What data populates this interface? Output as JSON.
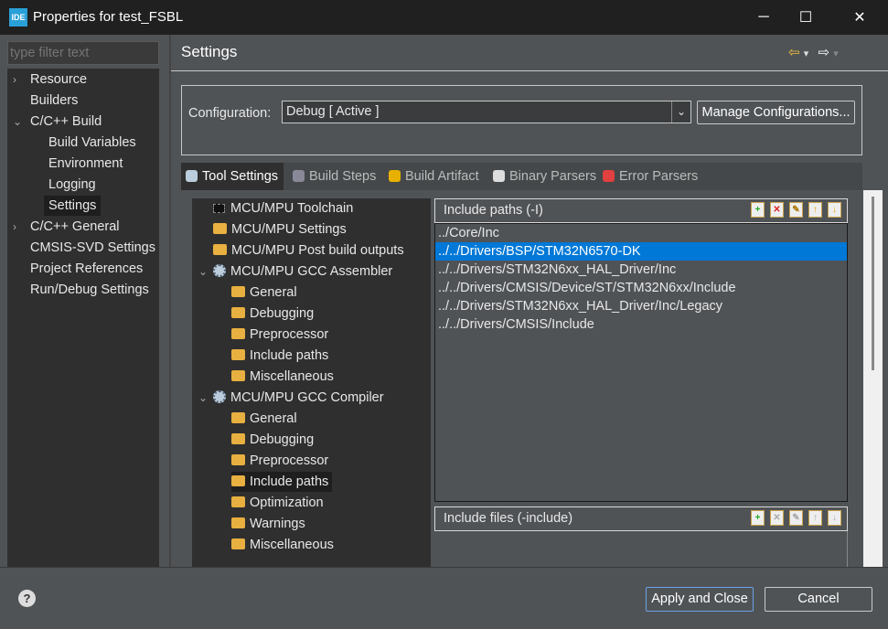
{
  "window": {
    "title": "Properties for test_FSBL",
    "logo": "IDE",
    "minimize": "─",
    "maximize": "☐",
    "close": "✕"
  },
  "filter": {
    "placeholder": "type filter text"
  },
  "left_tree": [
    {
      "label": "Resource",
      "chev": "›"
    },
    {
      "label": "Builders"
    },
    {
      "label": "C/C++ Build",
      "chev": "⌄"
    },
    {
      "label": "Build Variables",
      "child": true
    },
    {
      "label": "Environment",
      "child": true
    },
    {
      "label": "Logging",
      "child": true
    },
    {
      "label": "Settings",
      "child": true,
      "selected": true
    },
    {
      "label": "C/C++ General",
      "chev": "›"
    },
    {
      "label": "CMSIS-SVD Settings"
    },
    {
      "label": "Project References"
    },
    {
      "label": "Run/Debug Settings"
    }
  ],
  "header": {
    "title": "Settings",
    "back": "⇦",
    "forward": "⇨",
    "dropdown": "▾"
  },
  "configuration": {
    "label": "Configuration:",
    "value": "Debug  [ Active ]",
    "manage": "Manage Configurations..."
  },
  "tabs": [
    {
      "label": "Tool Settings",
      "icon": "gear-icon",
      "active": true
    },
    {
      "label": "Build Steps",
      "icon": "build-steps-icon"
    },
    {
      "label": "Build Artifact",
      "icon": "trophy-icon"
    },
    {
      "label": "Binary Parsers",
      "icon": "binary-icon"
    },
    {
      "label": "Error Parsers",
      "icon": "error-icon"
    }
  ],
  "tool_tree": [
    {
      "label": "MCU/MPU Toolchain",
      "icon": "chip",
      "lvl": 0
    },
    {
      "label": "MCU/MPU Settings",
      "icon": "fold",
      "lvl": 0
    },
    {
      "label": "MCU/MPU Post build outputs",
      "icon": "fold",
      "lvl": 0
    },
    {
      "label": "MCU/MPU GCC Assembler",
      "icon": "gear",
      "lvl": 0,
      "chev": "⌄"
    },
    {
      "label": "General",
      "icon": "fold",
      "lvl": 1
    },
    {
      "label": "Debugging",
      "icon": "fold",
      "lvl": 1
    },
    {
      "label": "Preprocessor",
      "icon": "fold",
      "lvl": 1
    },
    {
      "label": "Include paths",
      "icon": "fold",
      "lvl": 1
    },
    {
      "label": "Miscellaneous",
      "icon": "fold",
      "lvl": 1
    },
    {
      "label": "MCU/MPU GCC Compiler",
      "icon": "gear",
      "lvl": 0,
      "chev": "⌄"
    },
    {
      "label": "General",
      "icon": "fold",
      "lvl": 1
    },
    {
      "label": "Debugging",
      "icon": "fold",
      "lvl": 1
    },
    {
      "label": "Preprocessor",
      "icon": "fold",
      "lvl": 1
    },
    {
      "label": "Include paths",
      "icon": "fold",
      "lvl": 1,
      "selected": true
    },
    {
      "label": "Optimization",
      "icon": "fold",
      "lvl": 1
    },
    {
      "label": "Warnings",
      "icon": "fold",
      "lvl": 1
    },
    {
      "label": "Miscellaneous",
      "icon": "fold",
      "lvl": 1
    }
  ],
  "include_paths": {
    "title": "Include paths (-I)",
    "items": [
      "../Core/Inc",
      "../../Drivers/BSP/STM32N6570-DK",
      "../../Drivers/STM32N6xx_HAL_Driver/Inc",
      "../../Drivers/CMSIS/Device/ST/STM32N6xx/Include",
      "../../Drivers/STM32N6xx_HAL_Driver/Inc/Legacy",
      "../../Drivers/CMSIS/Include"
    ],
    "selected_index": 1
  },
  "include_files": {
    "title": "Include files (-include)"
  },
  "toolbar_icons": [
    "add-icon",
    "delete-icon",
    "edit-icon",
    "move-up-icon",
    "move-down-icon"
  ],
  "footer": {
    "help": "?",
    "apply": "Apply and Close",
    "cancel": "Cancel"
  },
  "colors": {
    "selection": "#0078d7",
    "background": "#505356",
    "titlebar": "#202020"
  }
}
